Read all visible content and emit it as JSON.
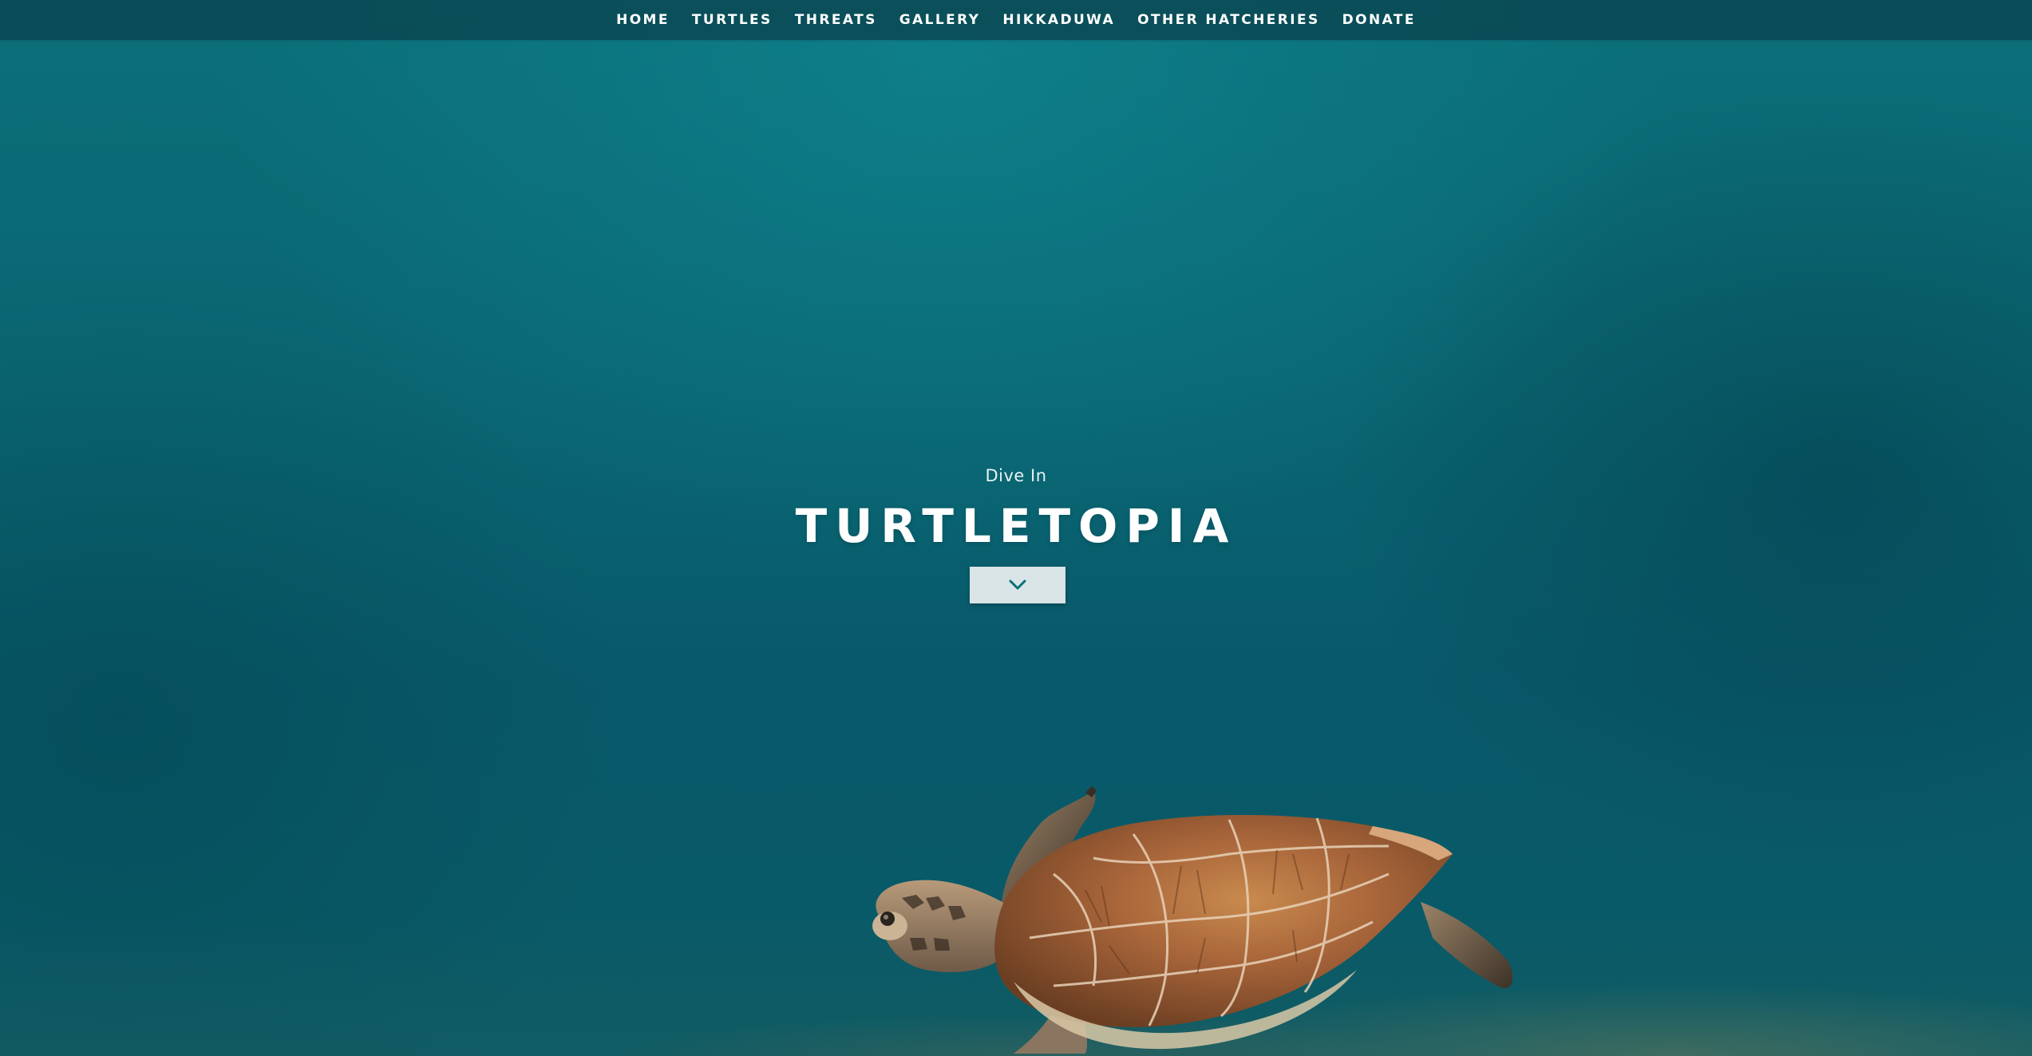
{
  "nav": {
    "items": [
      {
        "label": "HOME"
      },
      {
        "label": "TURTLES"
      },
      {
        "label": "THREATS"
      },
      {
        "label": "GALLERY"
      },
      {
        "label": "HIKKADUWA"
      },
      {
        "label": "OTHER HATCHERIES"
      },
      {
        "label": "DONATE"
      }
    ]
  },
  "hero": {
    "subtitle": "Dive In",
    "title": "TURTLETOPIA",
    "scroll_button_icon": "chevron-down-icon"
  },
  "colors": {
    "navbar_bg": "#0e5560",
    "ocean_top": "#0b6f79",
    "ocean_bottom": "#0a5a66",
    "button_bg": "#d9e4e7",
    "chevron": "#0b6f79",
    "text": "#ffffff"
  }
}
